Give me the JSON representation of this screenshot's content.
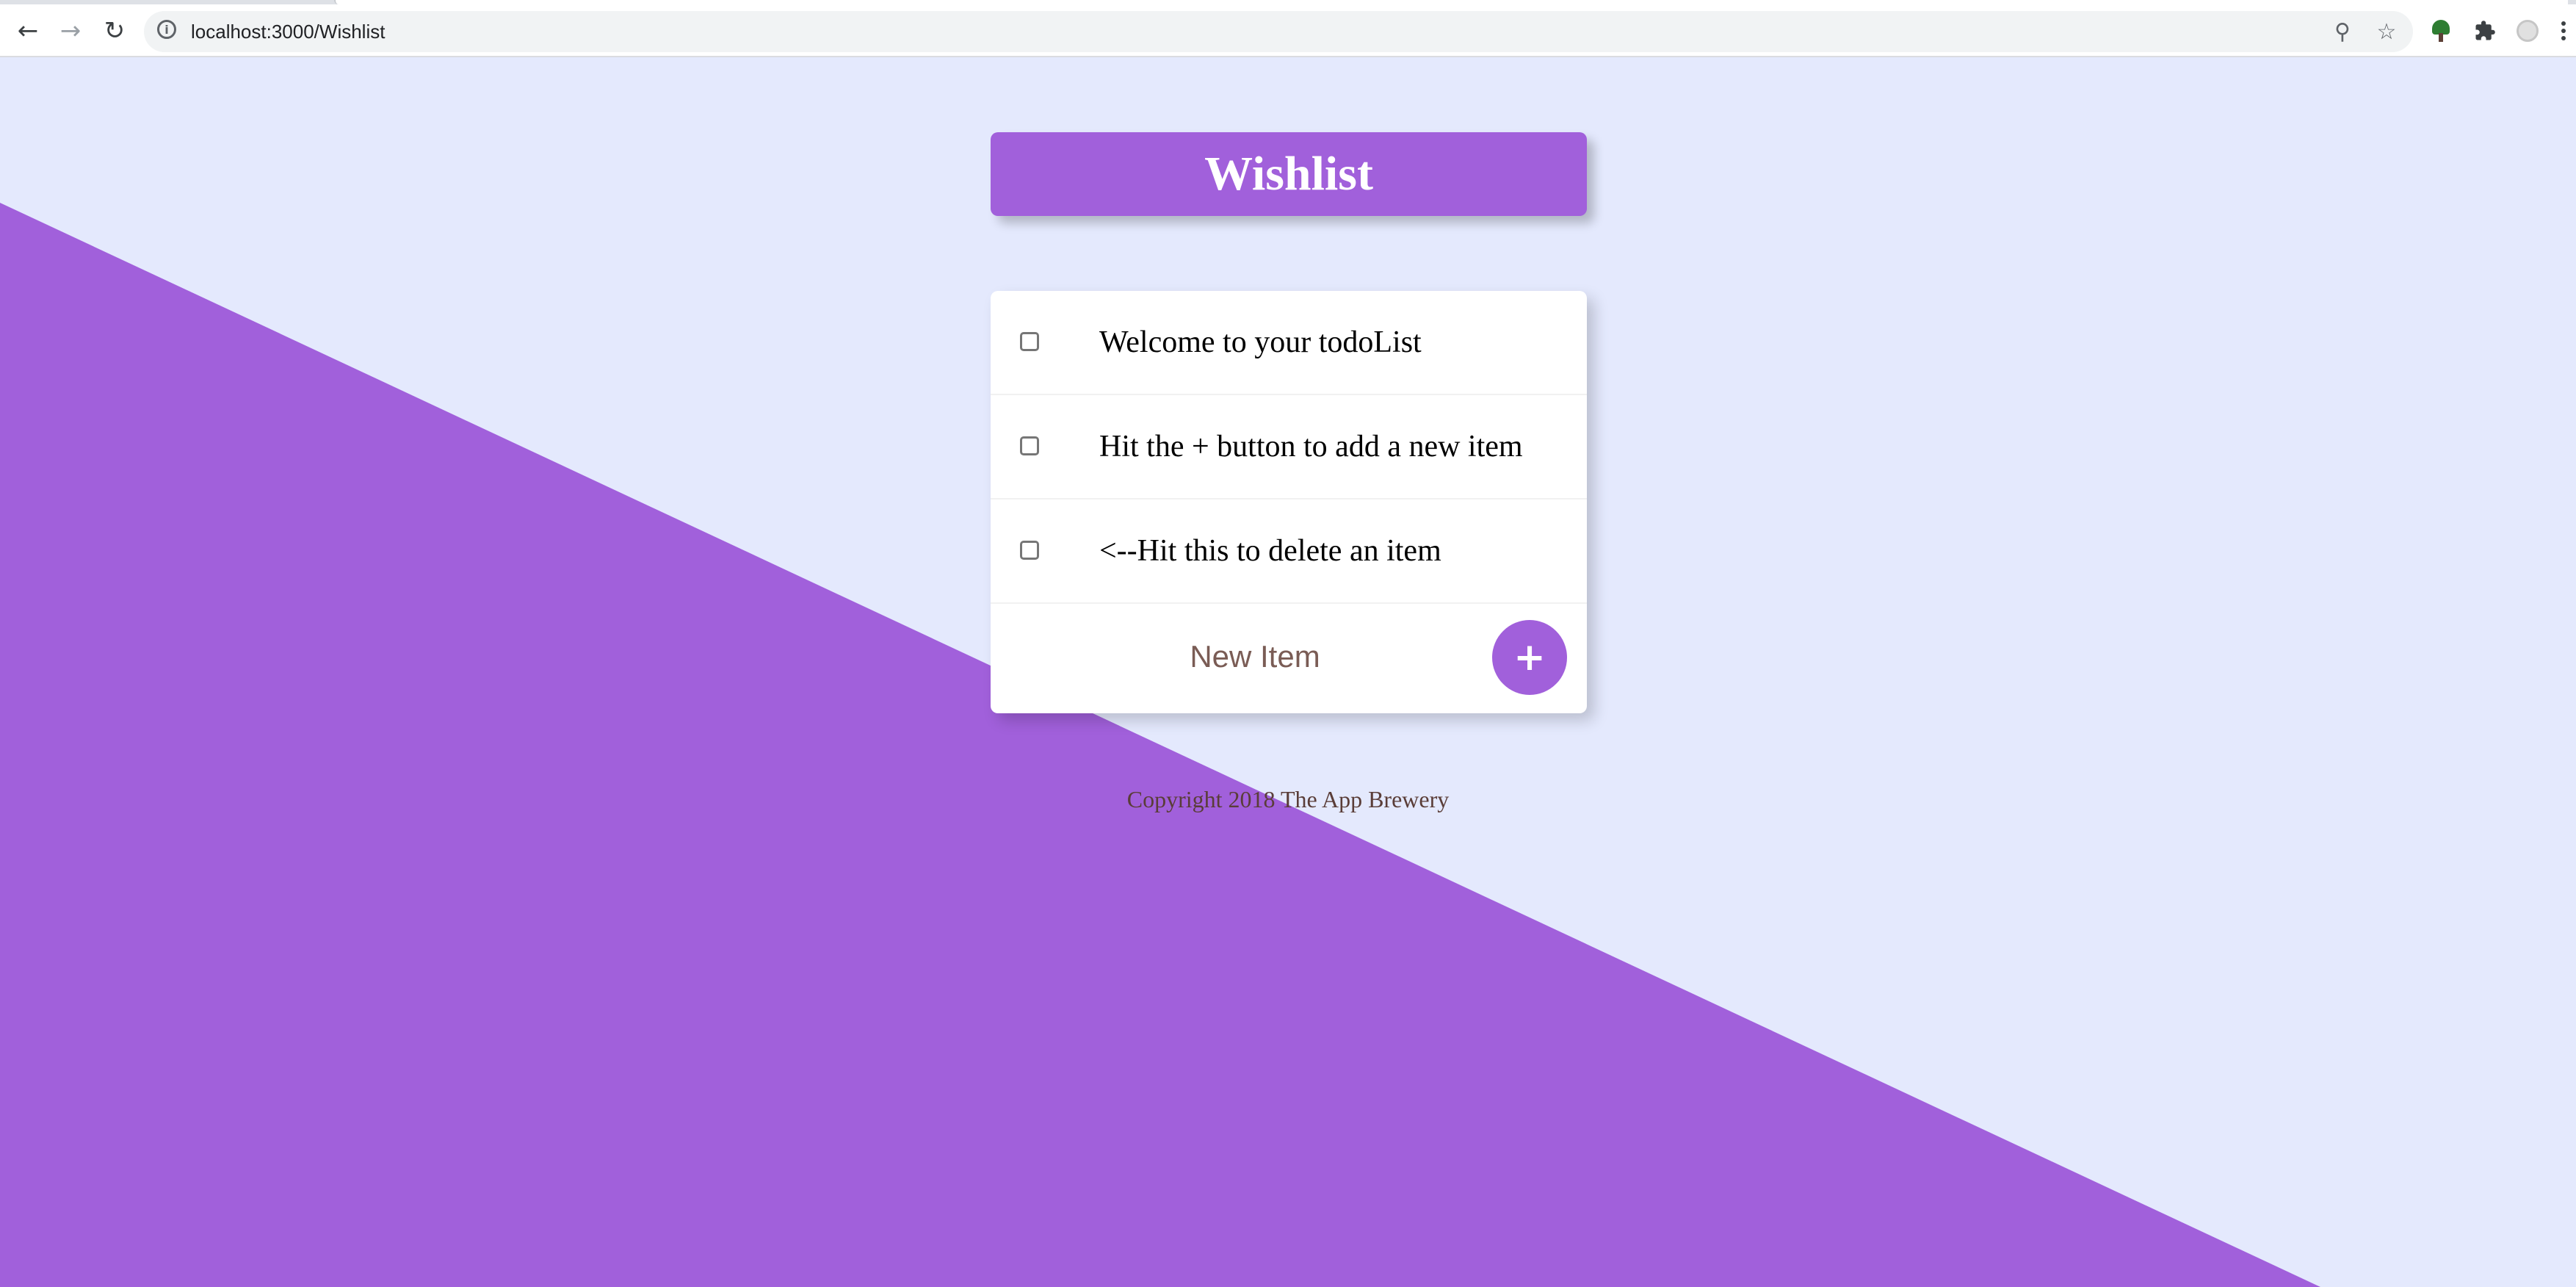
{
  "browser": {
    "url": "localhost:3000/Wishlist",
    "back_icon": "arrow-left-icon",
    "forward_icon": "arrow-right-icon",
    "reload_icon": "reload-icon",
    "site_info_icon": "info-icon",
    "zoom_icon": "zoom-icon",
    "bookmark_icon": "star-icon",
    "extension_icon": "tree-icon",
    "extensions_icon": "puzzle-icon",
    "profile_icon": "profile-icon",
    "menu_icon": "kebab-menu-icon"
  },
  "colors": {
    "page_background": "#E4E9FD",
    "accent": "#A160DB",
    "card_background": "#FFFFFF",
    "footer_text": "#5A3D38"
  },
  "heading": {
    "title": "Wishlist"
  },
  "items": [
    {
      "label": "Welcome to your todoList",
      "checked": false
    },
    {
      "label": "Hit the + button to add a new item",
      "checked": false
    },
    {
      "label": "<--Hit this to delete an item",
      "checked": false
    }
  ],
  "new_item": {
    "placeholder": "New Item",
    "value": "",
    "button_label": "+"
  },
  "footer": {
    "text": "Copyright 2018 The App Brewery"
  }
}
